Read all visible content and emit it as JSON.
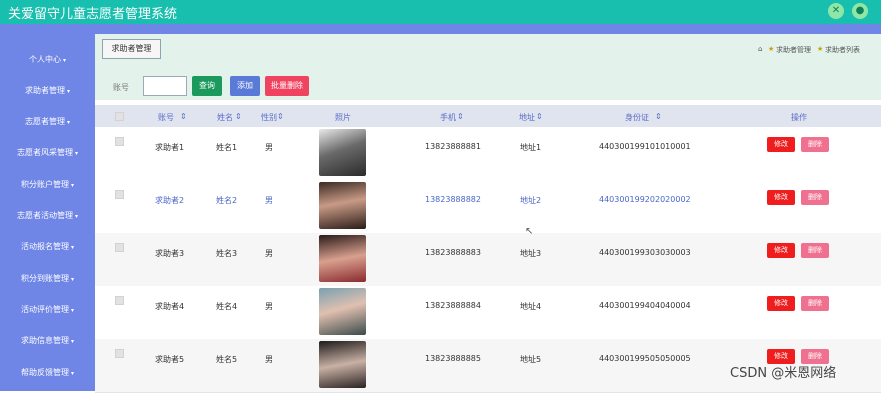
{
  "app": {
    "title": "关爱留守儿童志愿者管理系统"
  },
  "sidebar": {
    "items": [
      {
        "label": "个人中心"
      },
      {
        "label": "求助者管理"
      },
      {
        "label": "志愿者管理"
      },
      {
        "label": "志愿者风采管理"
      },
      {
        "label": "积分账户管理"
      },
      {
        "label": "志愿者活动管理"
      },
      {
        "label": "活动报名管理"
      },
      {
        "label": "积分到账管理"
      },
      {
        "label": "活动评价管理"
      },
      {
        "label": "求助信息管理"
      },
      {
        "label": "帮助反馈管理"
      }
    ]
  },
  "header": {
    "tag_label": "求助者管理",
    "breadcrumb": {
      "home_icon": "home-icon",
      "item1": "求助者管理",
      "item2": "求助者列表"
    }
  },
  "search": {
    "label": "账号",
    "value": ""
  },
  "buttons": {
    "query": "查询",
    "add": "添加",
    "batch_delete": "批量删除"
  },
  "columns": {
    "account": "账号",
    "name": "姓名",
    "gender": "性别",
    "photo": "照片",
    "phone": "手机",
    "address": "地址",
    "id_card": "身份证",
    "actions": "操作"
  },
  "row_actions": {
    "edit": "修改",
    "delete": "删除"
  },
  "rows": [
    {
      "account": "求助者1",
      "name": "姓名1",
      "gender": "男",
      "phone": "13823888881",
      "address": "地址1",
      "id_card": "440300199101010001"
    },
    {
      "account": "求助者2",
      "name": "姓名2",
      "gender": "男",
      "phone": "13823888882",
      "address": "地址2",
      "id_card": "440300199202020002"
    },
    {
      "account": "求助者3",
      "name": "姓名3",
      "gender": "男",
      "phone": "13823888883",
      "address": "地址3",
      "id_card": "440300199303030003"
    },
    {
      "account": "求助者4",
      "name": "姓名4",
      "gender": "男",
      "phone": "13823888884",
      "address": "地址4",
      "id_card": "440300199404040004"
    },
    {
      "account": "求助者5",
      "name": "姓名5",
      "gender": "男",
      "phone": "13823888885",
      "address": "地址5",
      "id_card": "440300199505050005"
    }
  ],
  "watermark": "CSDN @米恩网络",
  "colors": {
    "topbar": "#19bfae",
    "sidebar": "#6f86e6",
    "header_bg": "#e4f2ec",
    "query": "#1c9a5e",
    "add": "#5a7ad8",
    "batch_delete": "#f0435f",
    "edit": "#ef1d1d",
    "delete": "#f07090"
  }
}
